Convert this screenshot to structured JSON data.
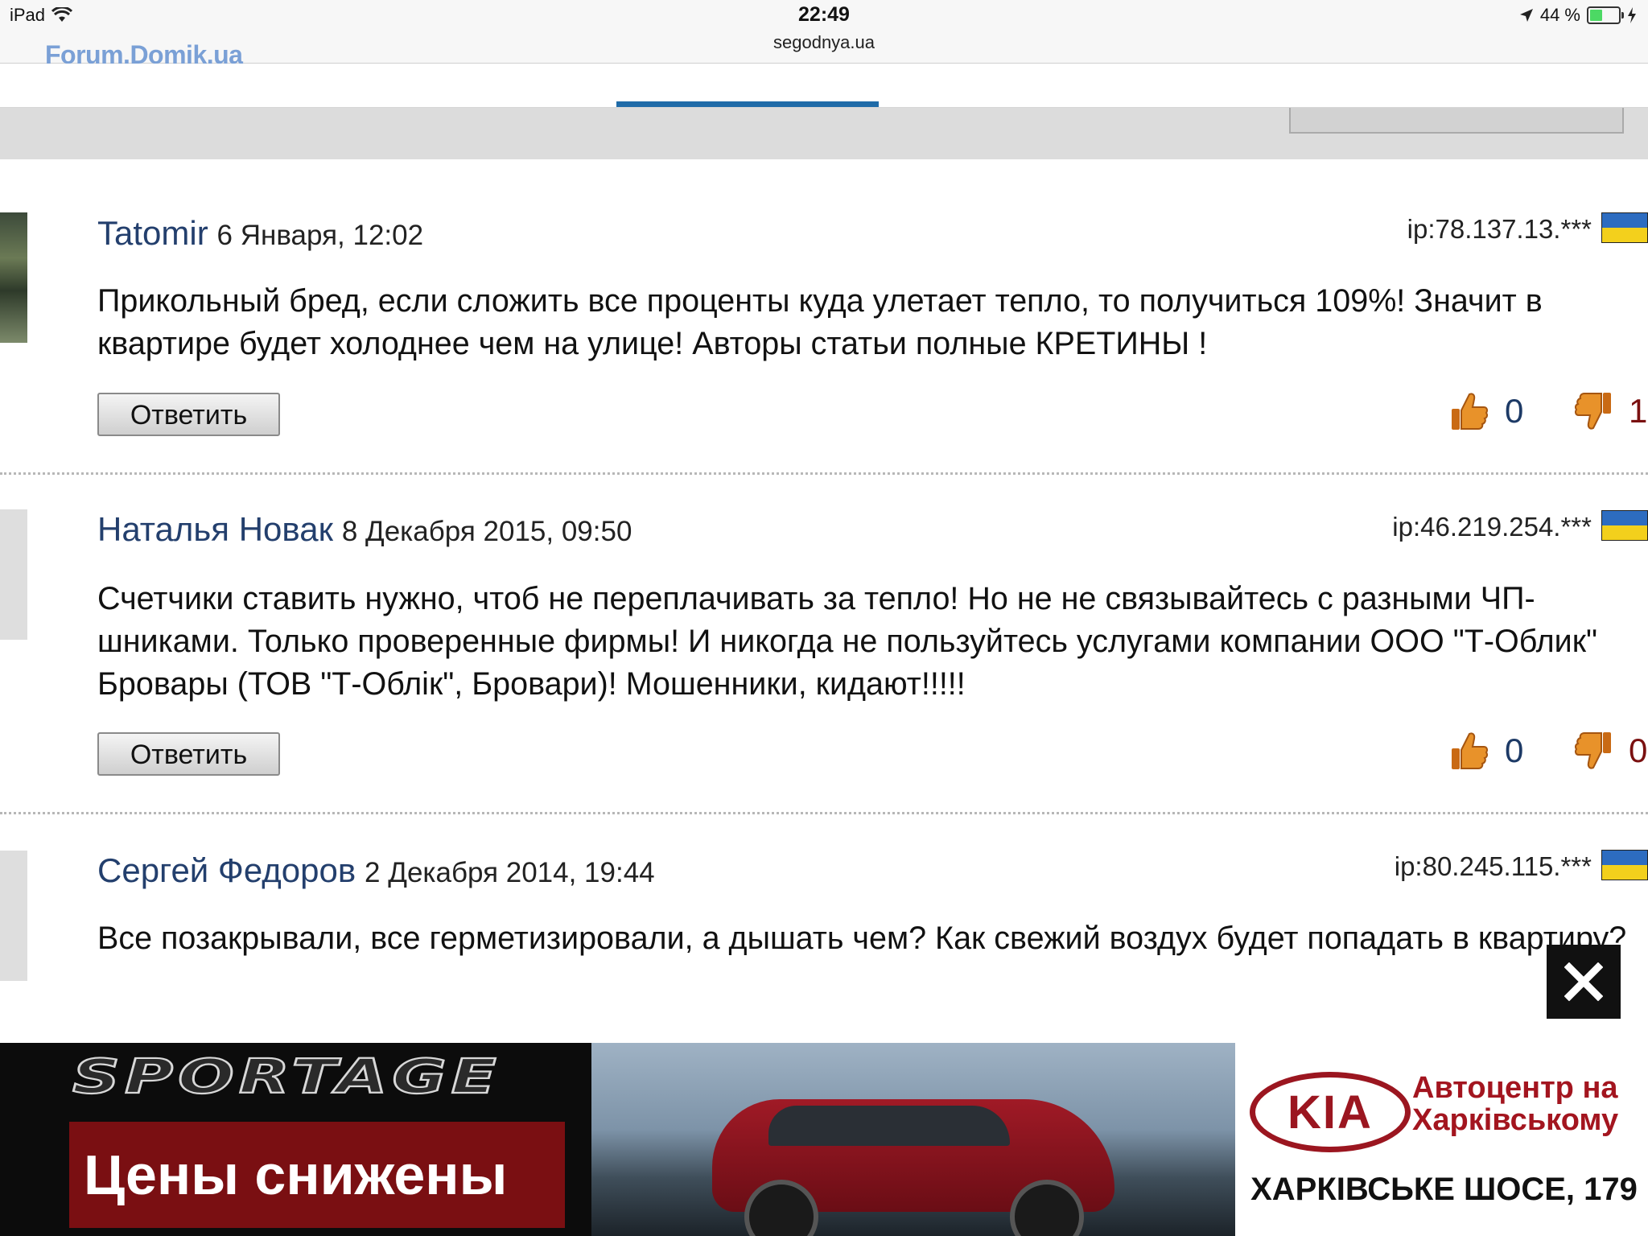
{
  "status_bar": {
    "device": "iPad",
    "time": "22:49",
    "url": "segodnya.ua",
    "battery": "44 %",
    "battery_level": 0.44
  },
  "site": {
    "logo": "Forum.Domik.ua"
  },
  "comments": [
    {
      "author": "Tatomir",
      "date": "6 Января, 12:02",
      "ip": "ip:78.137.13.***",
      "text": "Прикольный бред, если сложить все проценты куда улетает тепло, то получиться 109%! Значит в квартире будет холоднее чем на улице! Авторы статьи полные КРЕТИНЫ !",
      "reply_label": "Ответить",
      "likes": "0",
      "dislikes": "1"
    },
    {
      "author": "Наталья Новак",
      "date": "8 Декабря 2015, 09:50",
      "ip": "ip:46.219.254.***",
      "text": "Счетчики ставить нужно, чтоб не переплачивать за тепло! Но не не связывайтесь с разными ЧП-шниками. Только проверенные фирмы! И никогда не пользуйтесь услугами компании ООО \"Т-Облик\" Бровары (ТОВ \"Т-Облік\", Бровари)! Мошенники, кидают!!!!!",
      "reply_label": "Ответить",
      "likes": "0",
      "dislikes": "0"
    },
    {
      "author": "Сергей Федоров",
      "date": "2 Декабря 2014, 19:44",
      "ip": "ip:80.245.115.***",
      "text": "Все позакрывали, все герметизировали, а дышать чем? Как свежий воздух будет попадать в квартиру?"
    }
  ],
  "ad": {
    "model": "SPORTAGE",
    "slogan": "Цены снижены",
    "brand": "KIA",
    "dealer": "Автоцентр на Харківському",
    "address": "ХАРКІВСЬКЕ ШОСЕ, 179"
  },
  "colors": {
    "author": "#233f6d",
    "nav_active": "#1f6ba8",
    "dislike": "#7a1010",
    "thumb": "#e8922a",
    "ad_red": "#7a0f12",
    "kia_red": "#9b1620"
  },
  "icons": [
    "wifi-icon",
    "location-arrow-icon",
    "battery-icon",
    "thumb-up-icon",
    "thumb-down-icon",
    "close-icon",
    "ukraine-flag-icon"
  ]
}
